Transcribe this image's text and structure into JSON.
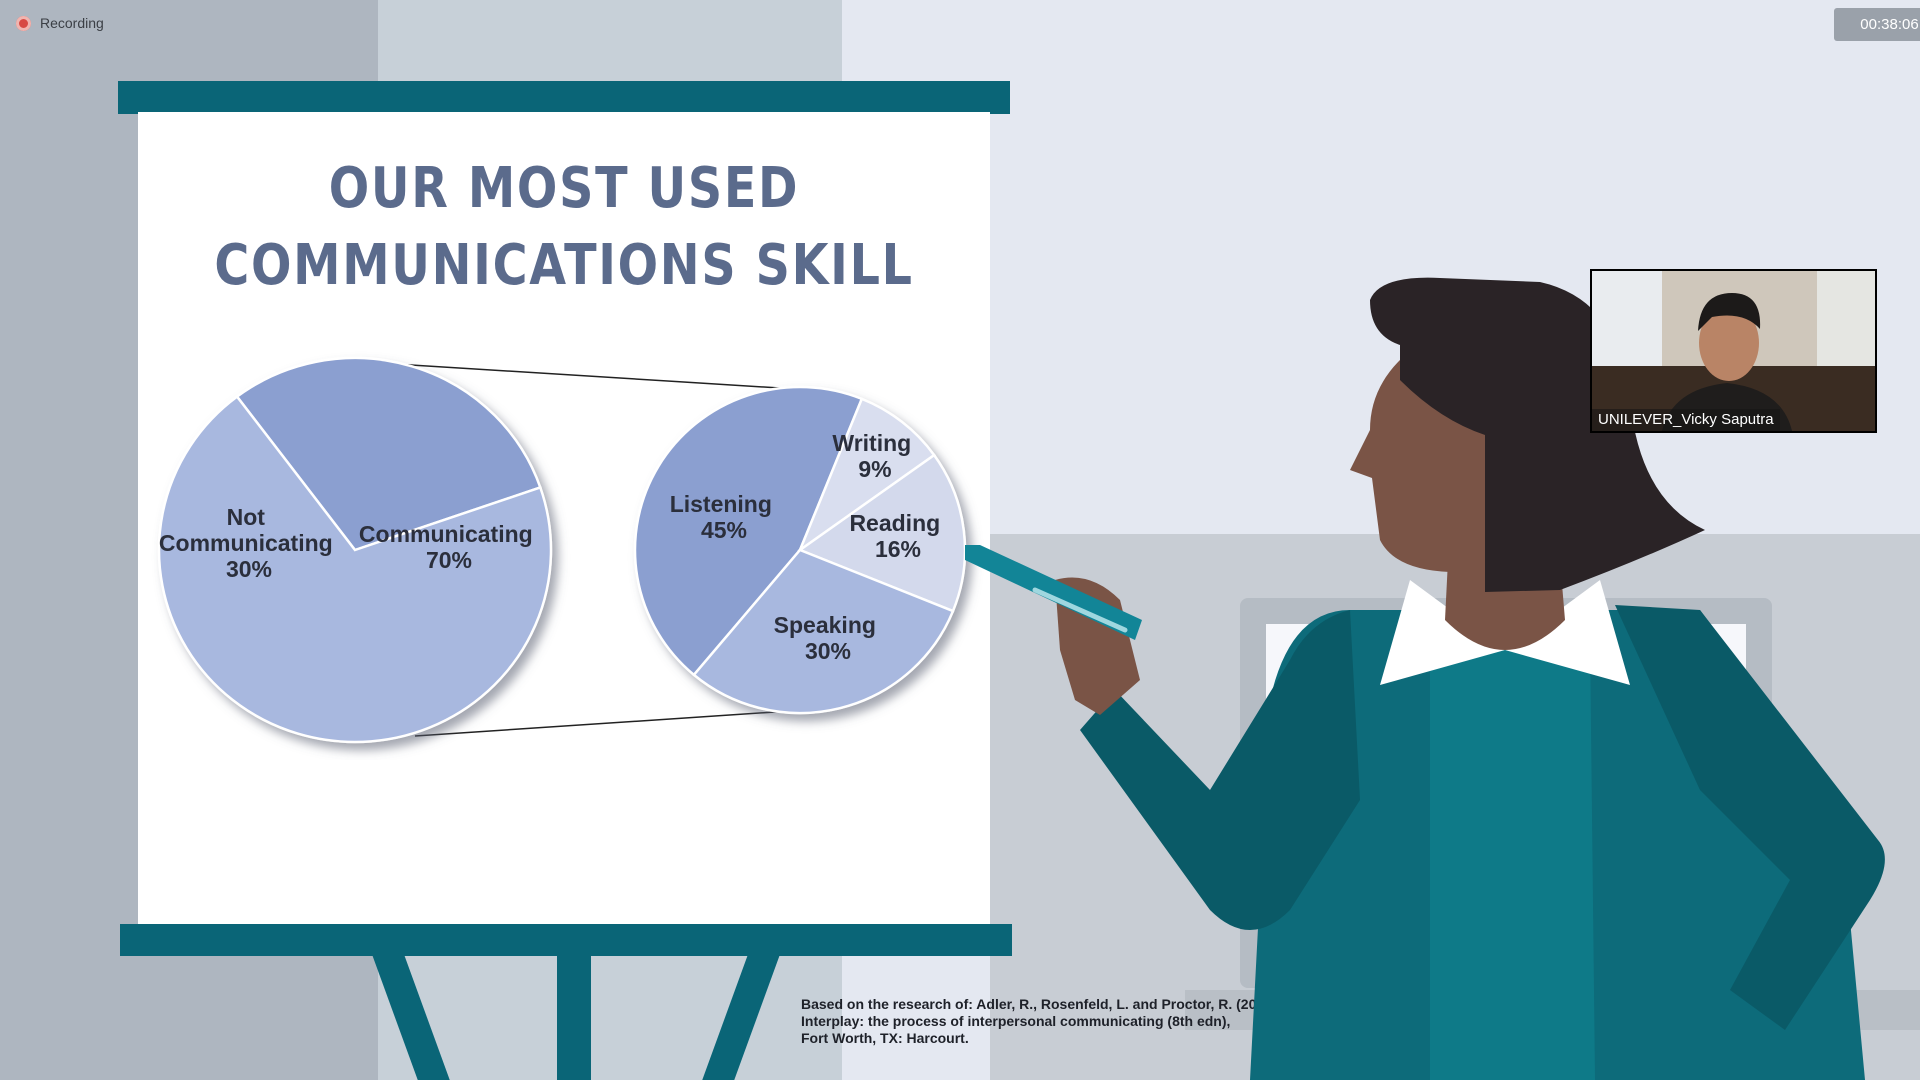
{
  "meeting": {
    "recording_label": "Recording",
    "elapsed_time": "00:38:06"
  },
  "slide": {
    "title_line1": "OUR MOST USED",
    "title_line2": "COMMUNICATIONS SKILL",
    "citation_line1": "Based on the research of: Adler, R., Rosenfeld, L. and Proctor, R. (2001)",
    "citation_line2": "Interplay: the process of interpersonal communicating (8th edn),",
    "citation_line3": "Fort Worth, TX: Harcourt."
  },
  "participant": {
    "name": "UNILEVER_Vicky Saputra"
  },
  "colors": {
    "easel": "#0a6577",
    "title": "#5b6b8c",
    "jacket": "#0d6b7a",
    "recording": "#d84a44"
  },
  "chart_data": [
    {
      "type": "pie",
      "slices": [
        {
          "label_line1": "Not",
          "label_line2": "Communicating",
          "value_label": "30%",
          "value": 30,
          "color": "#8b9fd0"
        },
        {
          "label_line1": "Communicating",
          "label_line2": "",
          "value_label": "70%",
          "value": 70,
          "color": "#a8b8df"
        }
      ]
    },
    {
      "type": "pie",
      "slices": [
        {
          "label_line1": "Listening",
          "value_label": "45%",
          "value": 45,
          "color": "#8b9fd0"
        },
        {
          "label_line1": "Writing",
          "value_label": "9%",
          "value": 9,
          "color": "#d9deef"
        },
        {
          "label_line1": "Reading",
          "value_label": "16%",
          "value": 16,
          "color": "#d3d9ec"
        },
        {
          "label_line1": "Speaking",
          "value_label": "30%",
          "value": 30,
          "color": "#a8b8df"
        }
      ]
    }
  ]
}
